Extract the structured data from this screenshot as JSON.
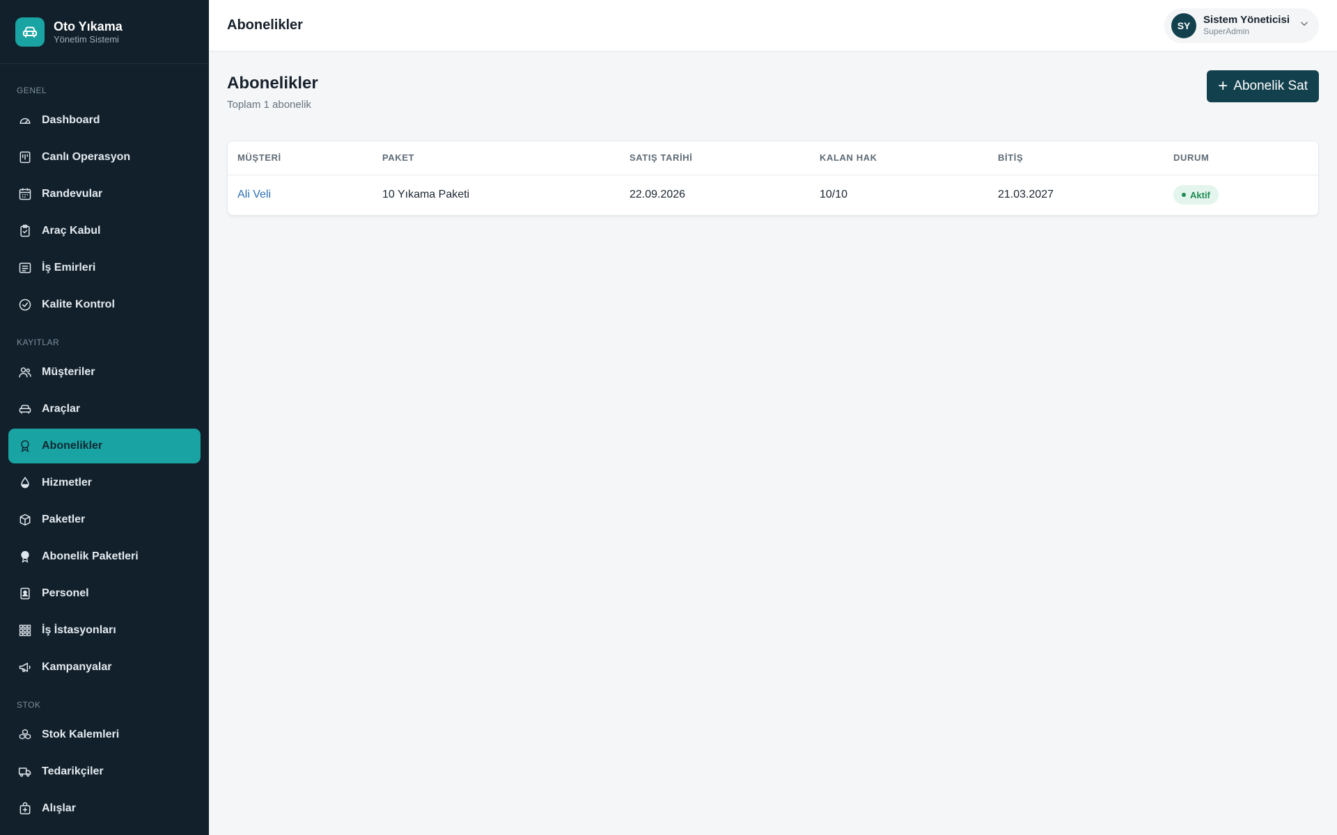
{
  "brand": {
    "title": "Oto Yıkama",
    "subtitle": "Yönetim Sistemi"
  },
  "sidebar": {
    "sections": [
      {
        "label": "GENEL"
      },
      {
        "label": "KAYITLAR"
      },
      {
        "label": "STOK"
      }
    ],
    "items": [
      {
        "label": "Dashboard",
        "icon": "gauge-icon"
      },
      {
        "label": "Canlı Operasyon",
        "icon": "live-board-icon"
      },
      {
        "label": "Randevular",
        "icon": "calendar-icon"
      },
      {
        "label": "Araç Kabul",
        "icon": "clipboard-check-icon"
      },
      {
        "label": "İş Emirleri",
        "icon": "list-icon"
      },
      {
        "label": "Kalite Kontrol",
        "icon": "check-circle-icon"
      },
      {
        "label": "Müşteriler",
        "icon": "users-icon"
      },
      {
        "label": "Araçlar",
        "icon": "car-icon"
      },
      {
        "label": "Abonelikler",
        "icon": "award-icon",
        "active": true
      },
      {
        "label": "Hizmetler",
        "icon": "droplet-icon"
      },
      {
        "label": "Paketler",
        "icon": "box-icon"
      },
      {
        "label": "Abonelik Paketleri",
        "icon": "medal-icon"
      },
      {
        "label": "Personel",
        "icon": "id-badge-icon"
      },
      {
        "label": "İş İstasyonları",
        "icon": "grid-icon"
      },
      {
        "label": "Kampanyalar",
        "icon": "megaphone-icon"
      },
      {
        "label": "Stok Kalemleri",
        "icon": "boxes-icon"
      },
      {
        "label": "Tedarikçiler",
        "icon": "truck-icon"
      },
      {
        "label": "Alışlar",
        "icon": "bag-plus-icon"
      }
    ]
  },
  "topbar": {
    "title": "Abonelikler"
  },
  "user": {
    "initials": "SY",
    "name": "Sistem Yöneticisi",
    "role": "SuperAdmin"
  },
  "page": {
    "title": "Abonelikler",
    "subtitle": "Toplam 1 abonelik",
    "primary_button": "Abonelik Sat"
  },
  "table": {
    "columns": [
      "MÜŞTERİ",
      "PAKET",
      "SATIŞ TARİHİ",
      "KALAN HAK",
      "BİTİŞ",
      "DURUM"
    ],
    "rows": [
      {
        "customer": "Ali Veli",
        "package": "10 Yıkama Paketi",
        "sale_date": "22.09.2026",
        "remaining": "10/10",
        "end_date": "21.03.2027",
        "status": "Aktif"
      }
    ]
  },
  "colors": {
    "sidebar_bg": "#12202b",
    "accent": "#1aa3a3",
    "primary": "#12404d",
    "link": "#2b6fb0",
    "status_active": "#1e8a55"
  }
}
